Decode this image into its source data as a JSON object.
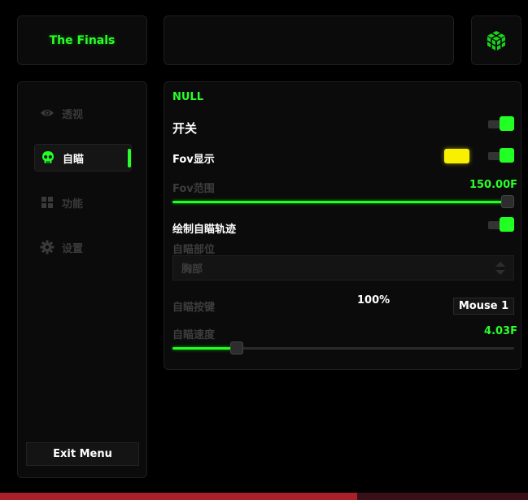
{
  "header": {
    "title": "The Finals"
  },
  "sidebar": {
    "items": [
      {
        "label": "透视",
        "icon": "eye-icon",
        "active": false
      },
      {
        "label": "自瞄",
        "icon": "skull-icon",
        "active": true
      },
      {
        "label": "功能",
        "icon": "grid-icon",
        "active": false
      },
      {
        "label": "设置",
        "icon": "gear-icon",
        "active": false
      }
    ],
    "exit_label": "Exit Menu"
  },
  "content": {
    "section_title": "NULL",
    "toggle_main_label": "开关",
    "fov_display_label": "Fov显示",
    "fov_color": "#f8f000",
    "fov_range_label": "Fov范围",
    "fov_range_value": "150.00F",
    "fov_range_fraction": 1.0,
    "draw_track_label": "绘制自瞄轨迹",
    "aim_part_label": "自瞄部位",
    "aim_part_value": "胸部",
    "aim_key_label": "自瞄按键",
    "aim_key_percent": "100%",
    "aim_key_value": "Mouse 1",
    "aim_speed_label": "自瞄速度",
    "aim_speed_value": "4.03F",
    "aim_speed_fraction": 0.175
  },
  "colors": {
    "accent": "#22ff22",
    "window_border": "#a8202a"
  }
}
